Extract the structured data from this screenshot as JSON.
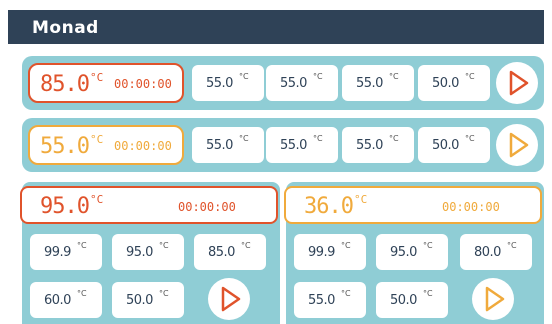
{
  "app": {
    "title": "Monad"
  },
  "row1": {
    "temp": "85.0",
    "unit": "°C",
    "timer": "00:00:00",
    "presets": [
      {
        "value": "55.0",
        "unit": "°C"
      },
      {
        "value": "55.0",
        "unit": "°C"
      },
      {
        "value": "55.0",
        "unit": "°C"
      },
      {
        "value": "50.0",
        "unit": "°C"
      }
    ]
  },
  "row2": {
    "temp": "55.0",
    "unit": "°C",
    "timer": "00:00:00",
    "presets": [
      {
        "value": "55.0",
        "unit": "°C"
      },
      {
        "value": "55.0",
        "unit": "°C"
      },
      {
        "value": "55.0",
        "unit": "°C"
      },
      {
        "value": "50.0",
        "unit": "°C"
      }
    ]
  },
  "left_panel": {
    "temp": "95.0",
    "unit": "°C",
    "timer": "00:00:00",
    "presets": [
      {
        "value": "99.9",
        "unit": "°C"
      },
      {
        "value": "95.0",
        "unit": "°C"
      },
      {
        "value": "85.0",
        "unit": "°C"
      },
      {
        "value": "60.0",
        "unit": "°C"
      },
      {
        "value": "50.0",
        "unit": "°C"
      }
    ]
  },
  "right_panel": {
    "temp": "36.0",
    "unit": "°C",
    "timer": "00:00:00",
    "presets": [
      {
        "value": "99.9",
        "unit": "°C"
      },
      {
        "value": "95.0",
        "unit": "°C"
      },
      {
        "value": "80.0",
        "unit": "°C"
      },
      {
        "value": "55.0",
        "unit": "°C"
      },
      {
        "value": "50.0",
        "unit": "°C"
      }
    ]
  },
  "colors": {
    "orange": "#e0532b",
    "amber": "#f0aa3c",
    "panel": "#8fcdd5",
    "header": "#2f4257"
  },
  "icons": {
    "play": "play-icon"
  }
}
